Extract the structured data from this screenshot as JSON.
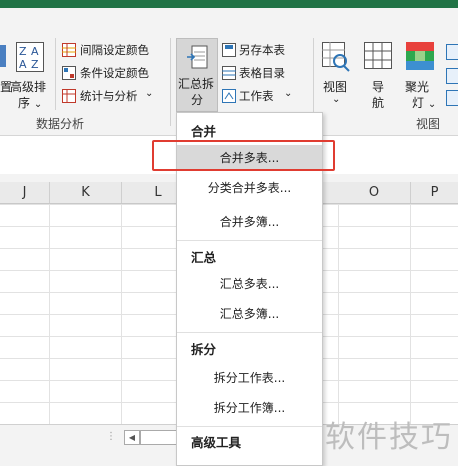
{
  "ribbon": {
    "left_partial_label": "置",
    "sort_button": {
      "line1": "高级排",
      "line2": "序",
      "chevron": "⌄"
    },
    "data_tools": [
      {
        "label": "间隔设定颜色",
        "icon": "interval-color-icon"
      },
      {
        "label": "条件设定颜色",
        "icon": "condition-color-icon"
      },
      {
        "label": "统计与分析",
        "icon": "statistics-icon"
      }
    ],
    "group_data_analysis": "数据分析",
    "summarize_split": {
      "line1": "汇总拆",
      "line2": "分"
    },
    "file_tools": [
      {
        "label": "另存本表",
        "icon": "save-sheet-icon"
      },
      {
        "label": "表格目录",
        "icon": "table-directory-icon"
      },
      {
        "label": "工作表",
        "icon": "worksheet-icon"
      }
    ],
    "view_button": "视图",
    "nav_button": {
      "line1": "导",
      "line2": "航"
    },
    "spotlight_button": {
      "line1": "聚光",
      "line2": "灯"
    },
    "group_view": "视图"
  },
  "columns": [
    "J",
    "K",
    "L",
    "O",
    "P"
  ],
  "menu": {
    "sections": [
      {
        "header": "合并",
        "items": [
          "合并多表...",
          "分类合并多表...",
          "合并多簿..."
        ]
      },
      {
        "header": "汇总",
        "items": [
          "汇总多表...",
          "汇总多簿..."
        ]
      },
      {
        "header": "拆分",
        "items": [
          "拆分工作表...",
          "拆分工作簿..."
        ]
      },
      {
        "header": "高级工具",
        "items": []
      }
    ],
    "highlighted_item": "合并多表..."
  },
  "watermark": "软件技巧",
  "colors": {
    "title_bar": "#217346",
    "highlight_box": "#e03c31"
  }
}
